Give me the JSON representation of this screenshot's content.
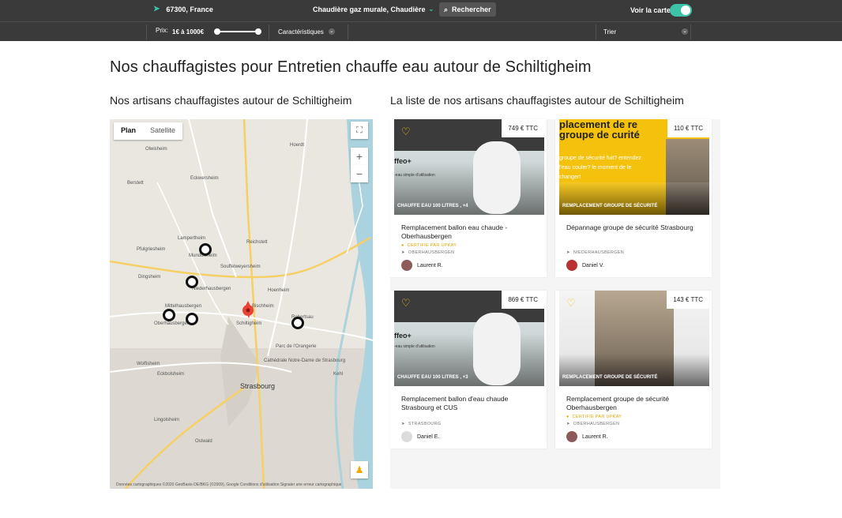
{
  "topbar": {
    "location": "67300, France",
    "category": "Chaudière gaz murale, Chaudière",
    "search_label": "Rechercher",
    "map_toggle_label": "Voir la carte",
    "price_label": "Prix:",
    "price_value": "1€ à 1000€",
    "characteristics_label": "Caractéristiques",
    "sort_label": "Trier"
  },
  "page": {
    "title": "Nos chauffagistes pour Entretien chauffe eau autour de Schiltigheim",
    "left_heading": "Nos artisans chauffagistes autour de Schiltigheim",
    "right_heading": "La liste de nos artisans chauffagistes autour de Schiltigheim"
  },
  "map": {
    "tabs": [
      "Plan",
      "Satellite"
    ],
    "zoom_in": "+",
    "zoom_out": "−",
    "credit": "Données cartographiques ©2020 GeoBasis-DE/BKG (©2009), Google   Conditions d'utilisation   Signaler une erreur cartographique",
    "labels": [
      "Olwisheim",
      "Hoerdt",
      "Berstett",
      "Eckwersheim",
      "Pfulgriesheim",
      "Lampertheim",
      "Reichstett",
      "Mundolsheim",
      "Souffelweyersheim",
      "Dingsheim",
      "Niederhausbergen",
      "Mittelhausbergen",
      "Oberhausbergen",
      "Schiltigheim",
      "Bischheim",
      "Hoenheim",
      "Robertsau",
      "Parc de l'Orangerie",
      "Cathédrale Notre-Dame de Strasbourg",
      "Wolfisheim",
      "Eckbolsheim",
      "Strasbourg",
      "Kehl",
      "Lingolsheim",
      "Ostwald"
    ]
  },
  "cards": [
    {
      "price": "749 € TTC",
      "tag": "CHAUFFE EAU 100 LITRES , +4",
      "title": "Remplacement ballon eau chaude - Oberhausbergen",
      "certified": "CERTIFIÉ PAR UPKAY",
      "city": "OBERHAUSBERGEN",
      "person": "Laurent R."
    },
    {
      "price": "110 € TTC",
      "tag": "REMPLACEMENT GROUPE DE SÉCURITÉ",
      "title": "Dépannage groupe de sécurité Strasbourg",
      "certified": "",
      "city": "NIEDERHAUSBERGEN",
      "person": "Daniel V."
    },
    {
      "price": "869 € TTC",
      "tag": "CHAUFFE EAU 100 LITRES , +3",
      "title": "Remplacement ballon d'eau chaude Strasbourg et CUS",
      "certified": "",
      "city": "STRASBOURG",
      "person": "Daniel E."
    },
    {
      "price": "143 € TTC",
      "tag": "REMPLACEMENT GROUPE DE SÉCURITÉ",
      "title": "Remplacement groupe de sécurité Oberhausbergen",
      "certified": "CERTIFIÉ PAR UPKAY",
      "city": "OBERHAUSBERGEN",
      "person": "Laurent R."
    }
  ],
  "card_images": {
    "water_heater_text": "ffeo+",
    "water_heater_sub": "-eau simple d'utilisation",
    "security_text": "placement de re groupe de curité",
    "security_sub": "groupe de sécurité fuit? entendez l'eau couler? le moment de le changer!"
  }
}
